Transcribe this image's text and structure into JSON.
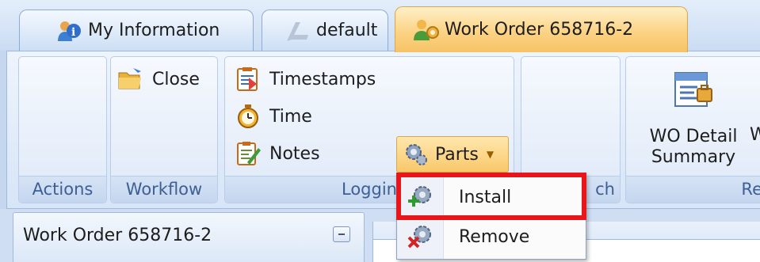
{
  "tabs": [
    {
      "label": "My Information",
      "icon": "users-info-icon"
    },
    {
      "label": "default",
      "icon": "default-view-icon"
    },
    {
      "label": "Work Order 658716-2",
      "icon": "workorder-users-icon",
      "active": true
    }
  ],
  "ribbon": {
    "groups": {
      "actions": "Actions",
      "workflow": "Workflow",
      "logging": "Loggin",
      "search": "ch",
      "reports": "Re"
    },
    "buttons": {
      "close": "Close",
      "timestamps": "Timestamps",
      "time": "Time",
      "notes": "Notes",
      "parts": "Parts",
      "wo_detail_line1": "WO Detail",
      "wo_detail_line2": "Summary",
      "wo_next_partial": "W"
    }
  },
  "parts_menu": {
    "items": [
      {
        "label": "Install",
        "icon": "install-part-icon"
      },
      {
        "label": "Remove",
        "icon": "remove-part-icon"
      }
    ]
  },
  "panel": {
    "title": "Work Order 658716-2"
  },
  "colors": {
    "active_tab": "#fbd385",
    "highlight_border": "#e8151b",
    "group_label": "#3e5f93"
  }
}
